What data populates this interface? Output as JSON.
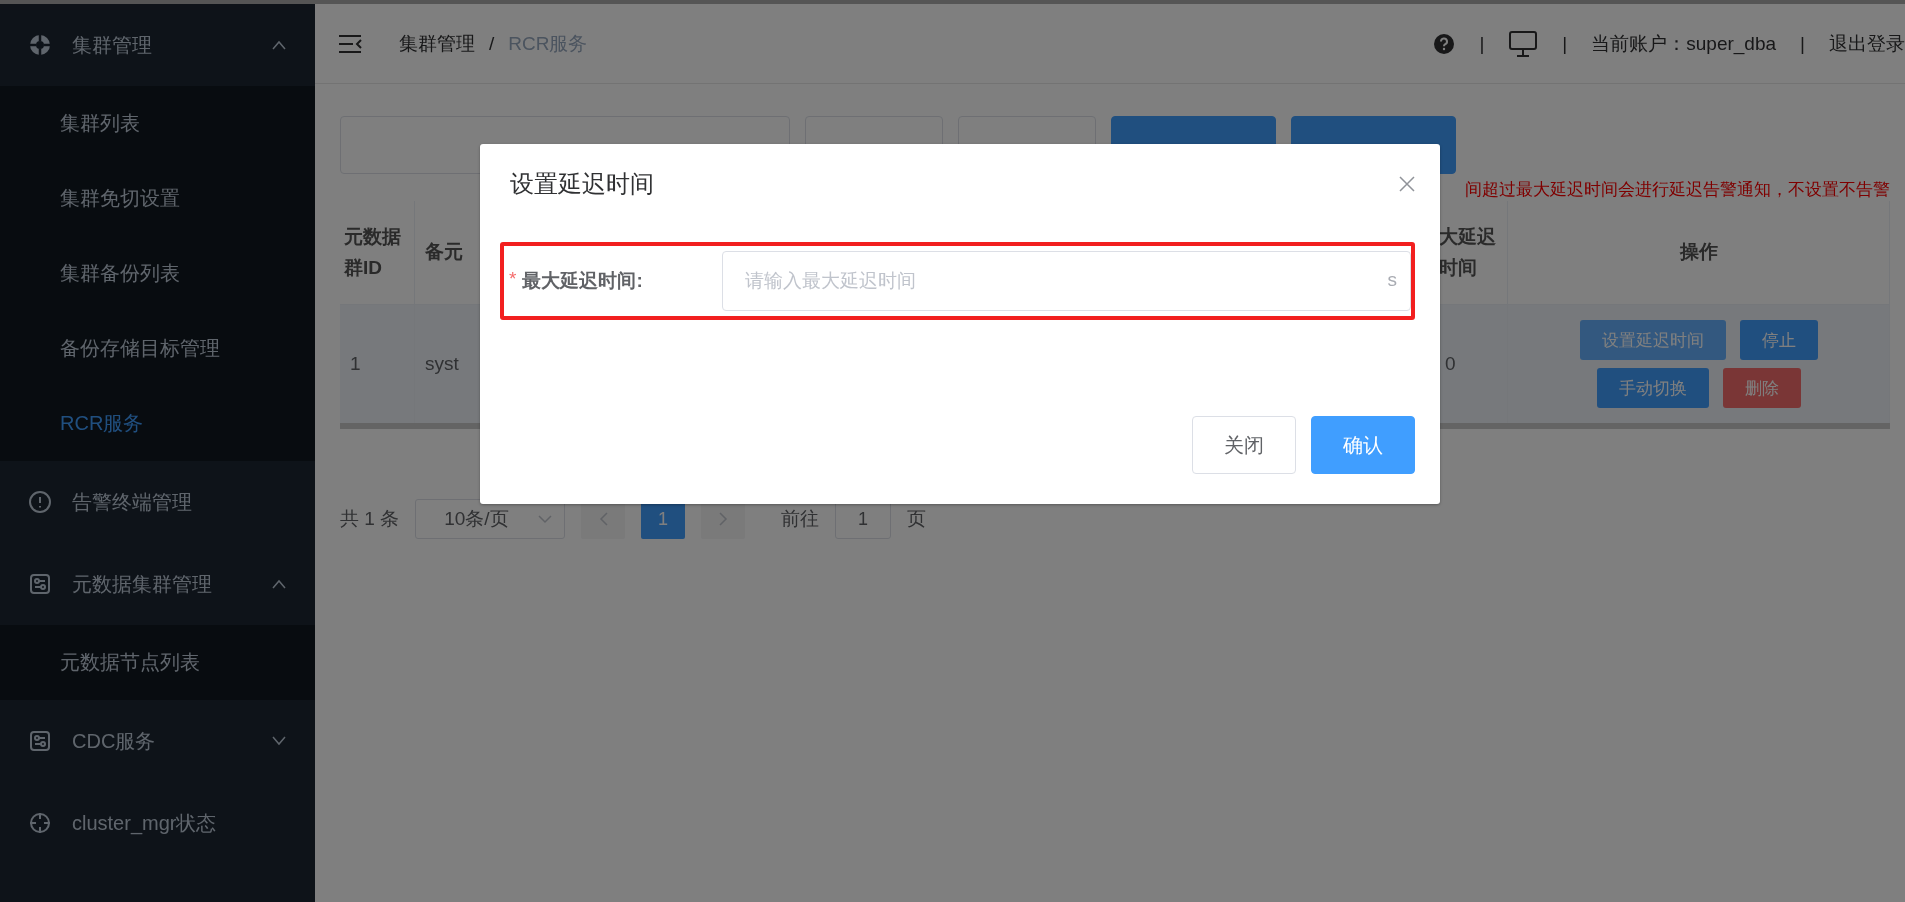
{
  "sidebar": {
    "items": [
      {
        "label": "集群管理",
        "expanded": true,
        "children": [
          {
            "label": "集群列表",
            "selected": false
          },
          {
            "label": "集群免切设置",
            "selected": false
          },
          {
            "label": "集群备份列表",
            "selected": false
          },
          {
            "label": "备份存储目标管理",
            "selected": false
          },
          {
            "label": "RCR服务",
            "selected": true
          }
        ]
      },
      {
        "label": "告警终端管理"
      },
      {
        "label": "元数据集群管理",
        "expanded": true,
        "children": [
          {
            "label": "元数据节点列表",
            "selected": false
          }
        ]
      },
      {
        "label": "CDC服务",
        "expanded": false
      },
      {
        "label": "cluster_mgr状态"
      }
    ]
  },
  "header": {
    "breadcrumb": [
      "集群管理",
      "RCR服务"
    ],
    "separator": "/",
    "divider": "|",
    "account": "当前账户：super_dba",
    "logout": "退出登录"
  },
  "toolbar": {
    "buttons": [
      {
        "kind": "plain"
      },
      {
        "kind": "plain"
      },
      {
        "kind": "primary"
      },
      {
        "kind": "primary"
      }
    ],
    "note": "间超过最大延迟时间会进行延迟告警通知，不设置不告警"
  },
  "table": {
    "columns": [
      "元数据群ID",
      "备元",
      "大延迟时间",
      "操作"
    ],
    "rows": [
      {
        "cells": [
          "1",
          "syst",
          "0"
        ],
        "actions": [
          {
            "label": "设置延迟时间",
            "kind": "light"
          },
          {
            "label": "停止",
            "kind": "primary"
          },
          {
            "label": "手动切换",
            "kind": "primary"
          },
          {
            "label": "删除",
            "kind": "danger"
          }
        ]
      }
    ]
  },
  "pagination": {
    "total": "共 1 条",
    "page_size": "10条/页",
    "pages": [
      {
        "label": "1",
        "selected": true
      }
    ],
    "goto_label": "前往",
    "goto_value": "1",
    "goto_suffix": "页"
  },
  "dialog": {
    "title": "设置延迟时间",
    "field": {
      "label": "最大延迟时间:",
      "required_mark": "*",
      "placeholder": "请输入最大延迟时间",
      "suffix": "s"
    },
    "buttons": [
      {
        "label": "关闭",
        "kind": "plain"
      },
      {
        "label": "确认",
        "kind": "primary"
      }
    ]
  }
}
